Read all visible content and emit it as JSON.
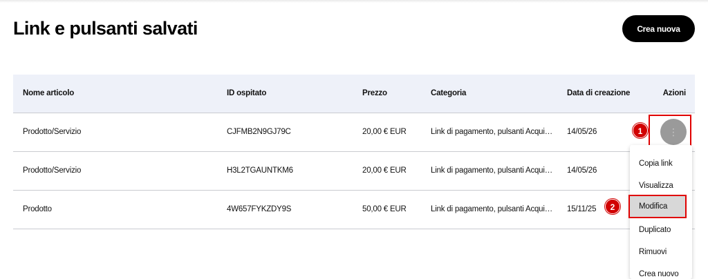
{
  "page": {
    "title": "Link e pulsanti salvati",
    "create_button": "Crea nuova"
  },
  "table": {
    "headers": {
      "name": "Nome articolo",
      "id": "ID ospitato",
      "price": "Prezzo",
      "category": "Categoria",
      "date": "Data di creazione",
      "actions": "Azioni"
    },
    "rows": [
      {
        "name": "Prodotto/Servizio",
        "id": "CJFMB2N9GJ79C",
        "price": "20,00 € EUR",
        "category": "Link di pagamento, pulsanti Acquista ora",
        "date": "14/05/26"
      },
      {
        "name": "Prodotto/Servizio",
        "id": "H3L2TGAUNTKM6",
        "price": "20,00 € EUR",
        "category": "Link di pagamento, pulsanti Acquista ora",
        "date": "14/05/26"
      },
      {
        "name": "Prodotto",
        "id": "4W657FYKZDY9S",
        "price": "50,00 € EUR",
        "category": "Link di pagamento, pulsanti Acquista ora",
        "date": "15/11/25"
      }
    ]
  },
  "actions_menu": {
    "items": [
      "Copia link",
      "Visualizza",
      "Modifica",
      "Duplicato",
      "Rimuovi",
      "Crea nuovo"
    ],
    "highlighted": "Modifica"
  },
  "kebab": {
    "icon": "more-vertical-icon",
    "glyph": "⋮"
  },
  "annotations": {
    "step1": "1",
    "step2": "2"
  },
  "colors": {
    "accent": "#000000",
    "highlight_border": "#e00000",
    "header_bg": "#eef1f9",
    "badge": "#d10000"
  }
}
